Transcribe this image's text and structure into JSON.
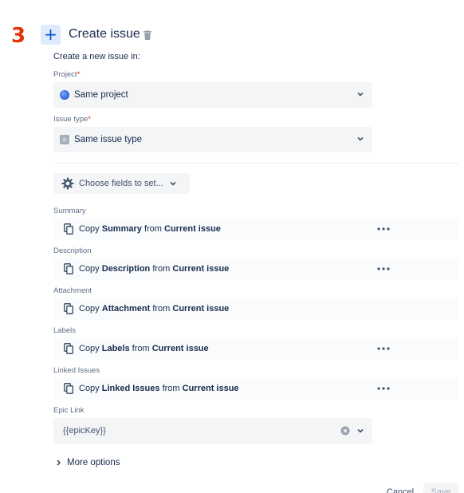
{
  "step": {
    "number": "3"
  },
  "header": {
    "add_icon": "plus-icon",
    "title": "Create issue",
    "delete_icon": "trash-icon"
  },
  "form": {
    "subtitle": "Create a new issue in:",
    "project": {
      "label": "Project",
      "required": "*",
      "value": "Same project",
      "icon": "globe-icon"
    },
    "issue_type": {
      "label": "Issue type",
      "required": "*",
      "value": "Same issue type",
      "icon": "issue-type-icon"
    },
    "choose_fields": {
      "label": "Choose fields to set...",
      "icon": "gear-icon"
    },
    "rows": [
      {
        "label": "Summary",
        "prefix": "Copy",
        "field": "Summary",
        "from": "from",
        "source": "Current issue",
        "has_more": true
      },
      {
        "label": "Description",
        "prefix": "Copy",
        "field": "Description",
        "from": "from",
        "source": "Current issue",
        "has_more": true
      },
      {
        "label": "Attachment",
        "prefix": "Copy",
        "field": "Attachment",
        "from": "from",
        "source": "Current issue",
        "has_more": false
      },
      {
        "label": "Labels",
        "prefix": "Copy",
        "field": "Labels",
        "from": "from",
        "source": "Current issue",
        "has_more": true
      },
      {
        "label": "Linked Issues",
        "prefix": "Copy",
        "field": "Linked Issues",
        "from": "from",
        "source": "Current issue",
        "has_more": true
      }
    ],
    "epic_link": {
      "label": "Epic Link",
      "value": "{{epicKey}}"
    },
    "more_options": "More options"
  },
  "footer": {
    "cancel": "Cancel",
    "save": "Save"
  },
  "colors": {
    "accent": "#0052cc",
    "step": "#de350b",
    "required": "#de350b"
  }
}
